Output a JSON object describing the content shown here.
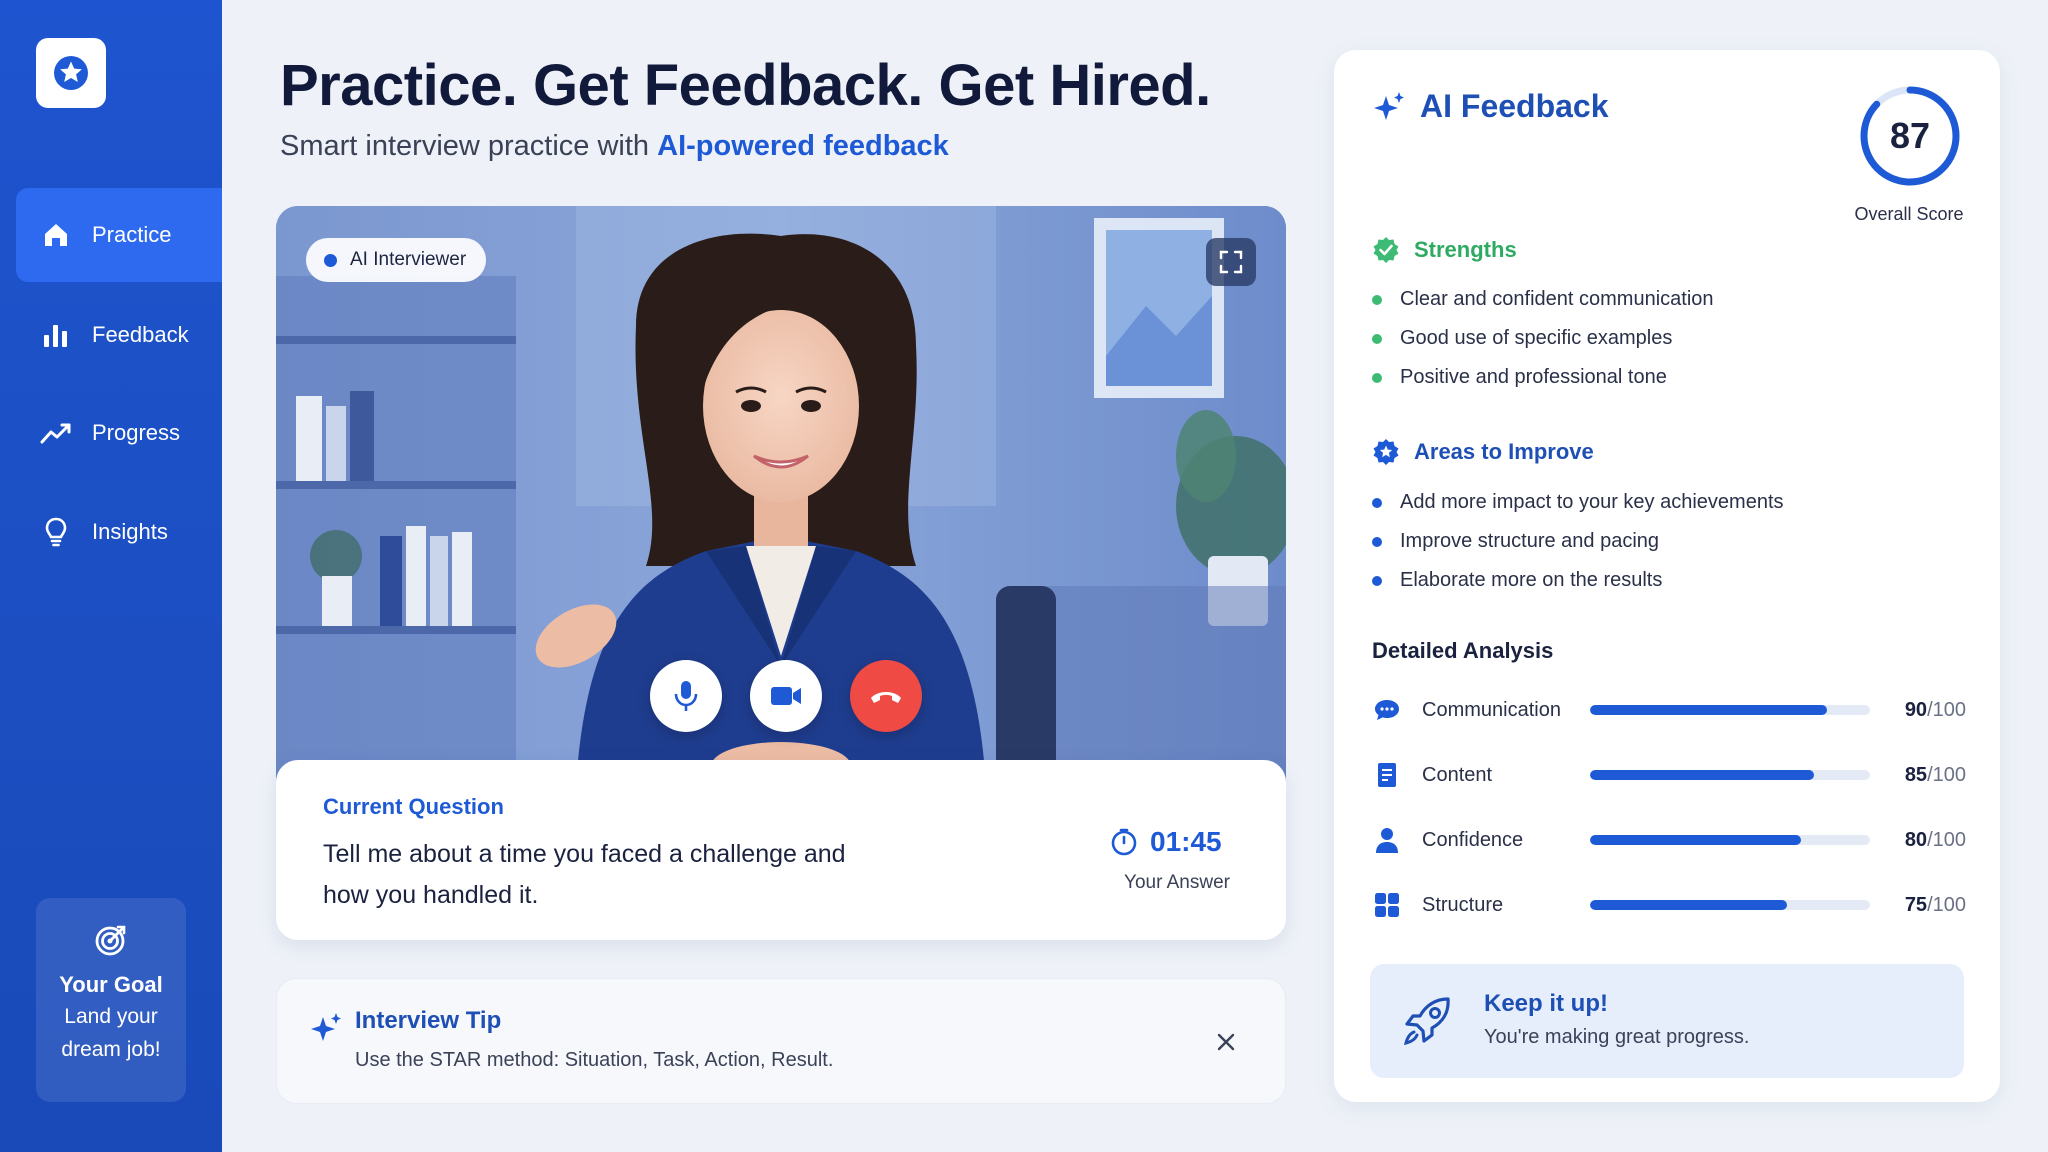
{
  "sidebar": {
    "logo_icon": "star-icon",
    "items": [
      {
        "label": "Practice",
        "icon": "home-icon",
        "active": true
      },
      {
        "label": "Feedback",
        "icon": "bar-chart-icon",
        "active": false
      },
      {
        "label": "Progress",
        "icon": "trend-icon",
        "active": false
      },
      {
        "label": "Insights",
        "icon": "lightbulb-icon",
        "active": false
      }
    ],
    "goal": {
      "icon": "target-icon",
      "title": "Your Goal",
      "text": "Land your dream job!"
    }
  },
  "header": {
    "title": "Practice. Get Feedback. Get Hired.",
    "subtitle_prefix": "Smart interview practice with ",
    "subtitle_accent": "AI-powered feedback"
  },
  "video": {
    "badge": "AI Interviewer",
    "controls": [
      "microphone-icon",
      "camera-icon",
      "end-call-icon"
    ]
  },
  "question": {
    "label": "Current Question",
    "text": "Tell me about a time you faced a challenge and how you handled it.",
    "timer": "01:45",
    "timer_label": "Your Answer"
  },
  "tip": {
    "title": "Interview Tip",
    "text": "Use the STAR method: Situation, Task, Action, Result."
  },
  "feedback": {
    "title": "AI Feedback",
    "score": "87",
    "score_value": 87,
    "score_label": "Overall Score",
    "strengths_title": "Strengths",
    "strengths": [
      "Clear and confident communication",
      "Good use of specific examples",
      "Positive and professional tone"
    ],
    "improve_title": "Areas to Improve",
    "improve": [
      "Add more impact to your key achievements",
      "Improve structure and pacing",
      "Elaborate more on the results"
    ],
    "analysis_title": "Detailed Analysis",
    "metrics": [
      {
        "name": "Communication",
        "score": "90",
        "value": 90,
        "max": "/100",
        "icon": "chat-icon"
      },
      {
        "name": "Content",
        "score": "85",
        "value": 85,
        "max": "/100",
        "icon": "document-icon"
      },
      {
        "name": "Confidence",
        "score": "80",
        "value": 80,
        "max": "/100",
        "icon": "person-icon"
      },
      {
        "name": "Structure",
        "score": "75",
        "value": 75,
        "max": "/100",
        "icon": "grid-icon"
      }
    ],
    "keep_title": "Keep it up!",
    "keep_text": "You're making great progress."
  },
  "colors": {
    "primary": "#1e5ad6",
    "sidebar": "#1e54cf",
    "success": "#3dbb74",
    "danger": "#ef4a43"
  }
}
